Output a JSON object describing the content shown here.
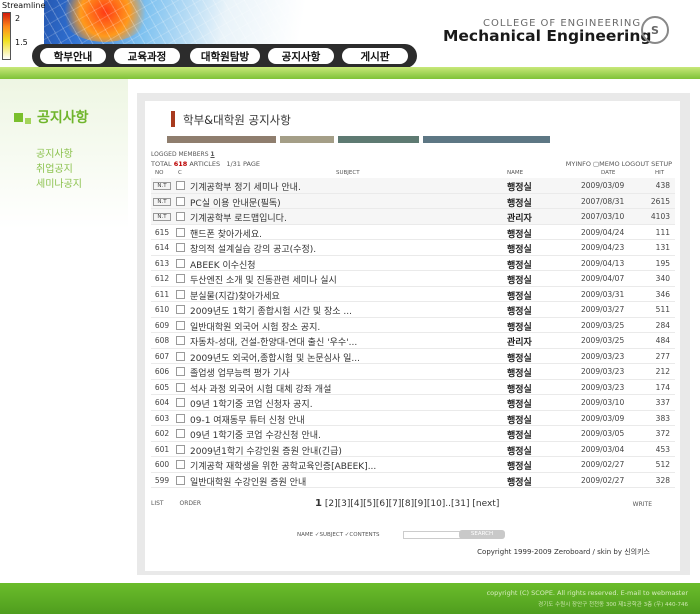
{
  "legend": {
    "title": "Streamline",
    "ticks": [
      "2",
      "1.5"
    ]
  },
  "brand": {
    "college": "COLLEGE OF ENGINEERING",
    "dept": "Mechanical Engineering"
  },
  "nav": [
    "학부안내",
    "교육과정",
    "대학원탐방",
    "공지사항",
    "게시판"
  ],
  "sidebar": {
    "title": "공지사항",
    "links": [
      "공지사항",
      "취업공지",
      "세미나공지"
    ]
  },
  "board": {
    "title": "학부&대학원 공지사항",
    "bar_colors": [
      "#8f7e6e",
      "#a49e87",
      "#5e7a72",
      "#5d7784"
    ],
    "members_label": "LOGGED MEMBERS",
    "members_count": "1",
    "total_label": "TOTAL",
    "total_count": "618",
    "articles_label": "ARTICLES",
    "page_info": "1/31 PAGE",
    "top_links": "MYINFO ▢MEMO LOGOUT SETUP",
    "columns": {
      "no": "NO",
      "c": "C",
      "subject": "SUBJECT",
      "name": "NAME",
      "date": "DATE",
      "hit": "HIT"
    },
    "rows": [
      {
        "no": "N.T",
        "notice": true,
        "subject": "기계공학부 정기 세미나 안내.",
        "name": "행정실",
        "date": "2009/03/09",
        "hit": "438"
      },
      {
        "no": "N.T",
        "notice": true,
        "subject": "PC실 이용 안내문(필독)",
        "name": "행정실",
        "date": "2007/08/31",
        "hit": "2615"
      },
      {
        "no": "N.T",
        "notice": true,
        "subject": "기계공학부 로드맵입니다.",
        "name": "관리자",
        "date": "2007/03/10",
        "hit": "4103"
      },
      {
        "no": "615",
        "subject": "핸드폰 찾아가세요.",
        "name": "행정실",
        "date": "2009/04/24",
        "hit": "111"
      },
      {
        "no": "614",
        "subject": "창의적 설계실습 강의 공고(수정).",
        "name": "행정실",
        "date": "2009/04/23",
        "hit": "131"
      },
      {
        "no": "613",
        "subject": "ABEEK 이수신청",
        "name": "행정실",
        "date": "2009/04/13",
        "hit": "195"
      },
      {
        "no": "612",
        "subject": "두산엔진 소개 및 진동관련 세미나 실시",
        "name": "행정실",
        "date": "2009/04/07",
        "hit": "340"
      },
      {
        "no": "611",
        "subject": "분실물(지갑)찾아가세요",
        "name": "행정실",
        "date": "2009/03/31",
        "hit": "346"
      },
      {
        "no": "610",
        "subject": "2009년도 1학기 종합시험 시간 및 장소 ...",
        "name": "행정실",
        "date": "2009/03/27",
        "hit": "511"
      },
      {
        "no": "609",
        "subject": "일반대학원 외국어 시험 장소 공지.",
        "name": "행정실",
        "date": "2009/03/25",
        "hit": "284"
      },
      {
        "no": "608",
        "subject": "자동차-성대, 건설-한양대-연대 출신 '우수'...",
        "name": "관리자",
        "date": "2009/03/25",
        "hit": "484"
      },
      {
        "no": "607",
        "subject": "2009년도 외국어,종합시험 및 논문심사 일...",
        "name": "행정실",
        "date": "2009/03/23",
        "hit": "277"
      },
      {
        "no": "606",
        "subject": "졸업생 업무능력 평가 기사",
        "name": "행정실",
        "date": "2009/03/23",
        "hit": "212"
      },
      {
        "no": "605",
        "subject": "석사 과정 외국어 시험 대체 강좌 개설",
        "name": "행정실",
        "date": "2009/03/23",
        "hit": "174"
      },
      {
        "no": "604",
        "subject": "09년 1학기중 코업 신청자 공지.",
        "name": "행정실",
        "date": "2009/03/10",
        "hit": "337"
      },
      {
        "no": "603",
        "subject": "09-1 여재동무 튜터 신청 안내",
        "name": "행정실",
        "date": "2009/03/09",
        "hit": "383"
      },
      {
        "no": "602",
        "subject": "09년 1학기중 코업 수강신청 안내.",
        "name": "행정실",
        "date": "2009/03/05",
        "hit": "372"
      },
      {
        "no": "601",
        "subject": "2009년1학기 수강인원 증원 안내(긴급)",
        "name": "행정실",
        "date": "2009/03/04",
        "hit": "453"
      },
      {
        "no": "600",
        "subject": "기계공학 재학생을 위한 공학교육인증[ABEEK]...",
        "name": "행정실",
        "date": "2009/02/27",
        "hit": "512"
      },
      {
        "no": "599",
        "subject": "일반대학원 수강인원 증원 안내",
        "name": "행정실",
        "date": "2009/02/27",
        "hit": "328"
      }
    ],
    "list_label": "LIST",
    "order_label": "ORDER",
    "write_label": "WRITE",
    "pager": {
      "current": "1",
      "others": "[2][3][4][5][6][7][8][9][10]..[31] [next]"
    },
    "search": {
      "name": "NAME",
      "subject": "SUBJECT",
      "contents": "CONTENTS",
      "button": "SEARCH"
    },
    "copyright": "Copyright 1999-2009 Zeroboard / skin by 신의키스"
  },
  "footer": {
    "line1": "copyright (C) SCOPE. All rights reserved. E-mail to webmaster",
    "line2": "경기도 수원시 장안구 천천동 300 제1공학관 3층 (우) 440-746"
  }
}
